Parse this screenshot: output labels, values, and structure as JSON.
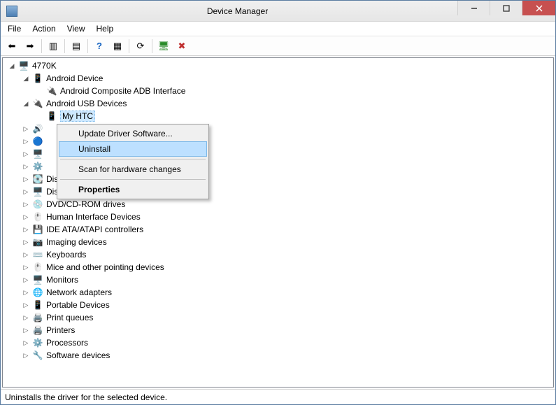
{
  "window": {
    "title": "Device Manager"
  },
  "menu": {
    "file": "File",
    "action": "Action",
    "view": "View",
    "help": "Help"
  },
  "tree": {
    "root": "4770K",
    "android_device": "Android Device",
    "android_adb": "Android Composite ADB Interface",
    "android_usb": "Android USB Devices",
    "my_htc": "My HTC",
    "nodes": [
      {
        "label": "Disk drives",
        "icon": "💽"
      },
      {
        "label": "Display adapters",
        "icon": "🖥️"
      },
      {
        "label": "DVD/CD-ROM drives",
        "icon": "💿"
      },
      {
        "label": "Human Interface Devices",
        "icon": "🖱️"
      },
      {
        "label": "IDE ATA/ATAPI controllers",
        "icon": "💾"
      },
      {
        "label": "Imaging devices",
        "icon": "📷"
      },
      {
        "label": "Keyboards",
        "icon": "⌨️"
      },
      {
        "label": "Mice and other pointing devices",
        "icon": "🖱️"
      },
      {
        "label": "Monitors",
        "icon": "🖥️"
      },
      {
        "label": "Network adapters",
        "icon": "🌐"
      },
      {
        "label": "Portable Devices",
        "icon": "📱"
      },
      {
        "label": "Print queues",
        "icon": "🖨️"
      },
      {
        "label": "Printers",
        "icon": "🖨️"
      },
      {
        "label": "Processors",
        "icon": "⚙️"
      },
      {
        "label": "Software devices",
        "icon": "🔧"
      }
    ]
  },
  "context_menu": {
    "update": "Update Driver Software...",
    "uninstall": "Uninstall",
    "scan": "Scan for hardware changes",
    "properties": "Properties"
  },
  "statusbar": {
    "text": "Uninstalls the driver for the selected device."
  }
}
